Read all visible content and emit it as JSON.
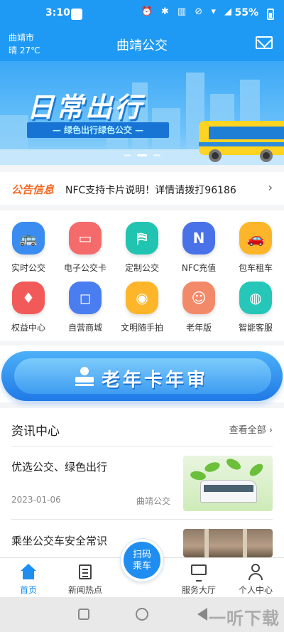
{
  "status_bar": {
    "time": "3:10",
    "battery": "55%",
    "icons": "⏰ ✱ ▥ ⊘ ▾ ◢"
  },
  "header": {
    "city": "曲靖市",
    "weather": "晴 27℃",
    "title": "曲靖公交",
    "mail_icon": "mail-icon"
  },
  "banner": {
    "title": "日常出行",
    "subtitle": "— 绿色出行绿色公交 —",
    "slide_count": 3,
    "active_slide": 2
  },
  "notice": {
    "tag": "公告信息",
    "text": "NFC支持卡片说明！详情请拨打96186",
    "arrow": "›"
  },
  "services": [
    {
      "label": "实时公交",
      "icon": "bus-icon",
      "glyph": "🚌",
      "color": "#3b8cf0"
    },
    {
      "label": "电子公交卡",
      "icon": "card-icon",
      "glyph": "▭",
      "color": "#f56a6a"
    },
    {
      "label": "定制公交",
      "icon": "custom-bus-icon",
      "glyph": "⛿",
      "color": "#21c4b0"
    },
    {
      "label": "NFC充值",
      "icon": "nfc-icon",
      "glyph": "N",
      "color": "#4a72e8"
    },
    {
      "label": "包车租车",
      "icon": "car-icon",
      "glyph": "🚗",
      "color": "#fdb52a"
    },
    {
      "label": "权益中心",
      "icon": "diamond-icon",
      "glyph": "♦",
      "color": "#f25a5a"
    },
    {
      "label": "自营商城",
      "icon": "shopping-bag-icon",
      "glyph": "◻",
      "color": "#4a7df0"
    },
    {
      "label": "文明随手拍",
      "icon": "camera-icon",
      "glyph": "◉",
      "color": "#fdb52a"
    },
    {
      "label": "老年版",
      "icon": "elder-icon",
      "glyph": "☺",
      "color": "#f28a6a"
    },
    {
      "label": "智能客服",
      "icon": "robot-icon",
      "glyph": "◍",
      "color": "#26c6b8"
    }
  ],
  "senior_card": {
    "text": "老年卡年审"
  },
  "news": {
    "title": "资讯中心",
    "more": "查看全部 ›",
    "articles": [
      {
        "title": "优选公交、绿色出行",
        "date": "2023-01-06",
        "source": "曲靖公交"
      },
      {
        "title": "乘坐公交车安全常识",
        "date": "",
        "source": ""
      }
    ]
  },
  "tabs": [
    {
      "label": "首页",
      "active": true
    },
    {
      "label": "新闻热点",
      "active": false
    },
    {
      "label": "扫码\n乘车",
      "active": false
    },
    {
      "label": "服务大厅",
      "active": false
    },
    {
      "label": "个人中心",
      "active": false
    }
  ],
  "scan_button": {
    "line1": "扫码",
    "line2": "乘车"
  },
  "watermark": "一听下载",
  "colors": {
    "primary": "#1f9af4",
    "accent": "#f36a24",
    "tab_active": "#1f8ef0"
  }
}
